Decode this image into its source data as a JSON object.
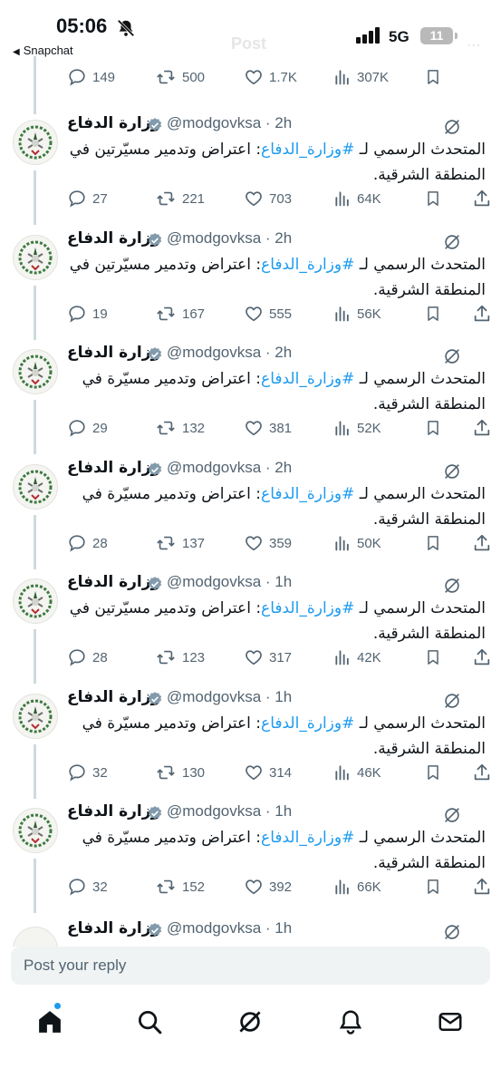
{
  "status_bar": {
    "time": "05:06",
    "back_app": "Snapchat",
    "faded_title": "Post",
    "network": "5G",
    "battery": "11"
  },
  "top_actions": {
    "replies": "149",
    "reposts": "500",
    "likes": "1.7K",
    "views": "307K"
  },
  "tweets": [
    {
      "name": "وزارة الدفاع",
      "handle": "@modgovksa · 2h",
      "text_before": "المتحدث الرسمي لـ ",
      "hashtag": "#وزارة_الدفاع",
      "text_after": ": اعتراض وتدمير مسيّرتين في المنطقة الشرقية.",
      "replies": "27",
      "reposts": "221",
      "likes": "703",
      "views": "64K"
    },
    {
      "name": "وزارة الدفاع",
      "handle": "@modgovksa · 2h",
      "text_before": "المتحدث الرسمي لـ ",
      "hashtag": "#وزارة_الدفاع",
      "text_after": ": اعتراض وتدمير مسيّرتين في المنطقة الشرقية.",
      "replies": "19",
      "reposts": "167",
      "likes": "555",
      "views": "56K"
    },
    {
      "name": "وزارة الدفاع",
      "handle": "@modgovksa · 2h",
      "text_before": "المتحدث الرسمي لـ ",
      "hashtag": "#وزارة_الدفاع",
      "text_after": ": اعتراض وتدمير مسيّرة في المنطقة الشرقية.",
      "replies": "29",
      "reposts": "132",
      "likes": "381",
      "views": "52K"
    },
    {
      "name": "وزارة الدفاع",
      "handle": "@modgovksa · 2h",
      "text_before": "المتحدث الرسمي لـ ",
      "hashtag": "#وزارة_الدفاع",
      "text_after": ": اعتراض وتدمير مسيّرة في المنطقة الشرقية.",
      "replies": "28",
      "reposts": "137",
      "likes": "359",
      "views": "50K"
    },
    {
      "name": "وزارة الدفاع",
      "handle": "@modgovksa · 1h",
      "text_before": "المتحدث الرسمي لـ ",
      "hashtag": "#وزارة_الدفاع",
      "text_after": ": اعتراض وتدمير مسيّرتين في المنطقة الشرقية.",
      "replies": "28",
      "reposts": "123",
      "likes": "317",
      "views": "42K"
    },
    {
      "name": "وزارة الدفاع",
      "handle": "@modgovksa · 1h",
      "text_before": "المتحدث الرسمي لـ ",
      "hashtag": "#وزارة_الدفاع",
      "text_after": ": اعتراض وتدمير مسيّرة في المنطقة الشرقية.",
      "replies": "32",
      "reposts": "130",
      "likes": "314",
      "views": "46K"
    },
    {
      "name": "وزارة الدفاع",
      "handle": "@modgovksa · 1h",
      "text_before": "المتحدث الرسمي لـ ",
      "hashtag": "#وزارة_الدفاع",
      "text_after": ": اعتراض وتدمير مسيّرة في المنطقة الشرقية.",
      "replies": "32",
      "reposts": "152",
      "likes": "392",
      "views": "66K"
    },
    {
      "name": "وزارة الدفاع",
      "handle": "@modgovksa · 1h"
    }
  ],
  "reply_bar": {
    "placeholder": "Post your reply"
  },
  "tabs": [
    "home-icon",
    "search-icon",
    "grok-icon",
    "notifications-icon",
    "messages-icon"
  ],
  "colors": {
    "accent": "#1d9bf0",
    "muted": "#536471",
    "verified": "#829aab"
  }
}
